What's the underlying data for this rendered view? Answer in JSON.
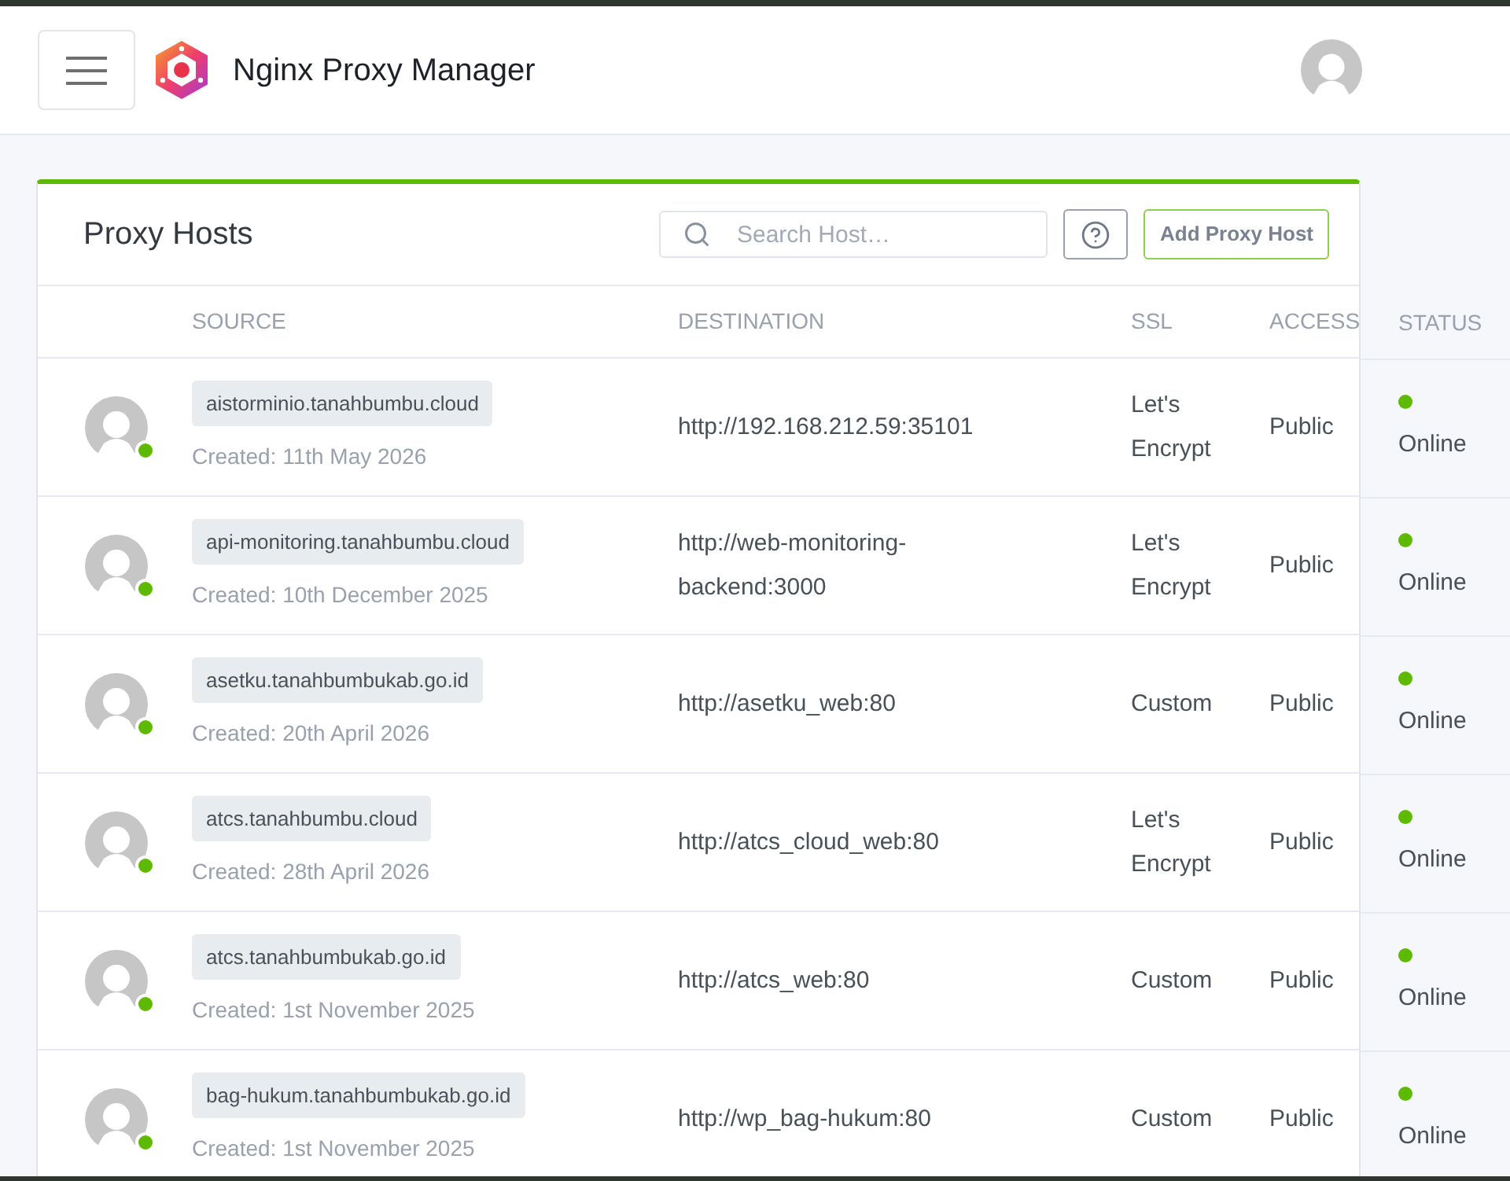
{
  "header": {
    "title": "Nginx Proxy Manager"
  },
  "card": {
    "title": "Proxy Hosts",
    "search": {
      "placeholder": "Search Host…"
    },
    "add_button": "Add Proxy Host"
  },
  "table": {
    "columns": [
      "SOURCE",
      "DESTINATION",
      "SSL",
      "ACCESS",
      "STATUS"
    ],
    "rows": [
      {
        "domain": "aistorminio.tanahbumbu.cloud",
        "created": "Created: 11th May 2026",
        "destination": "http://192.168.212.59:35101",
        "ssl": "Let's Encrypt",
        "access": "Public",
        "status": "Online",
        "online": true
      },
      {
        "domain": "api-monitoring.tanahbumbu.cloud",
        "created": "Created: 10th December 2025",
        "destination": "http://web-monitoring-backend:3000",
        "ssl": "Let's Encrypt",
        "access": "Public",
        "status": "Online",
        "online": true
      },
      {
        "domain": "asetku.tanahbumbukab.go.id",
        "created": "Created: 20th April 2026",
        "destination": "http://asetku_web:80",
        "ssl": "Custom",
        "access": "Public",
        "status": "Online",
        "online": true
      },
      {
        "domain": "atcs.tanahbumbu.cloud",
        "created": "Created: 28th April 2026",
        "destination": "http://atcs_cloud_web:80",
        "ssl": "Let's Encrypt",
        "access": "Public",
        "status": "Online",
        "online": true
      },
      {
        "domain": "atcs.tanahbumbukab.go.id",
        "created": "Created: 1st November 2025",
        "destination": "http://atcs_web:80",
        "ssl": "Custom",
        "access": "Public",
        "status": "Online",
        "online": true
      },
      {
        "domain": "bag-hukum.tanahbumbukab.go.id",
        "created": "Created: 1st November 2025",
        "destination": "http://wp_bag-hukum:80",
        "ssl": "Custom",
        "access": "Public",
        "status": "Online",
        "online": true
      }
    ]
  }
}
